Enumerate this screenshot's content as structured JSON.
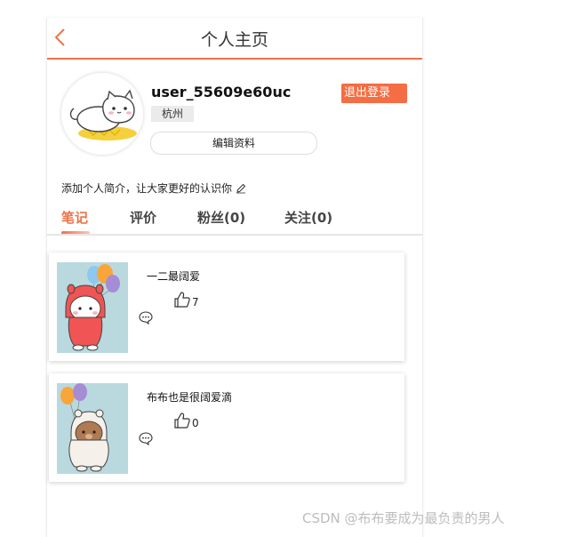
{
  "header": {
    "title": "个人主页"
  },
  "profile": {
    "username": "user_55609e60uc",
    "location": "杭州",
    "logout_label": "退出登录",
    "edit_label": "编辑资料",
    "bio": "添加个人简介，让大家更好的认识你"
  },
  "tabs": [
    {
      "label": "笔记"
    },
    {
      "label": "评价"
    },
    {
      "label": "粉丝(0)"
    },
    {
      "label": "关注(0)"
    }
  ],
  "active_tab": "笔记",
  "notes": [
    {
      "title": "一二最阔爱",
      "likes": "7",
      "thumb": "red-hooded-bear-with-balloons"
    },
    {
      "title": "布布也是很阔爱滴",
      "likes": "0",
      "thumb": "brown-bear-with-balloons"
    }
  ],
  "icons": {
    "back": "chevron-left-icon",
    "edit_bio": "pencil-icon",
    "like": "thumbs-up-icon",
    "comment": "comment-bubble-icon"
  },
  "colors": {
    "accent": "#f07148",
    "logout_bg": "#f46d43",
    "tag_bg": "#ebebeb"
  },
  "watermark": "CSDN @布布要成为最负责的男人"
}
